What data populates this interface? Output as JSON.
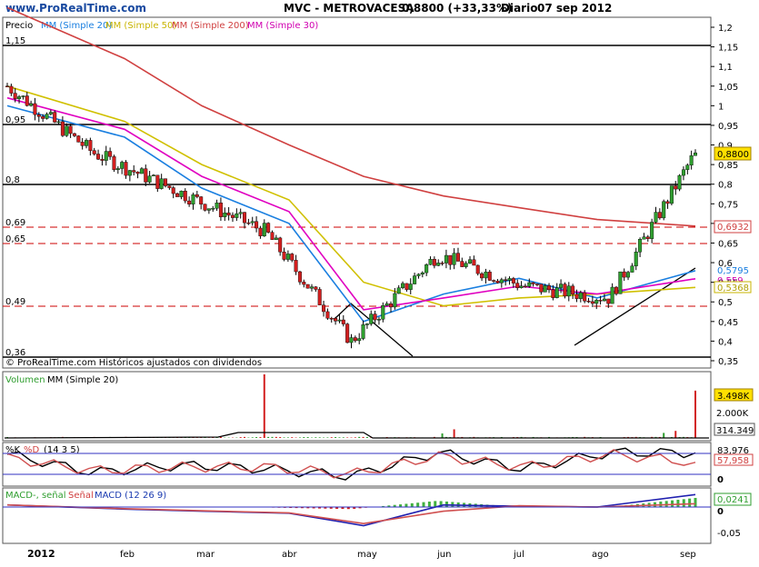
{
  "header": {
    "site": "www.ProRealTime.com",
    "ticker": "MVC - METROVACESA",
    "price": "0,8800 (+33,33%)",
    "period": "Diario",
    "date": "07 sep 2012"
  },
  "colors": {
    "up": "#2f9e2f",
    "down": "#d21f1f",
    "sma20": "#1a7fe0",
    "sma50": "#d0c000",
    "sma200": "#d04040",
    "sma30": "#e000c0",
    "macd": "#2020b0",
    "signal": "#d05050",
    "hist": "#40b040",
    "support": "#000000",
    "dashed": "#cc0000"
  },
  "price_panel": {
    "legend": {
      "precio": "Precio",
      "sma20": "MM (Simple 20)",
      "sma50": "MM (Simple 50)",
      "sma200": "MM (Simple 200)",
      "sma30": "MM (Simple 30)"
    },
    "footer": "© ProRealTime.com Históricos ajustados con dividendos",
    "left_levels": [
      "1,15",
      "0,95",
      "0,8",
      "0,69",
      "0,65",
      "0,49",
      "0,36"
    ],
    "right_ticks": [
      "1,2",
      "1,15",
      "1,1",
      "1,05",
      "1",
      "0,95",
      "0,9",
      "0,85",
      "0,8",
      "0,75",
      "0,7",
      "0,65",
      "0,6",
      "0,55",
      "0,5",
      "0,45",
      "0,4",
      "0,35"
    ],
    "value_labels": {
      "last": "0,8800",
      "sma200": "0,6932",
      "sma20": "0,5795",
      "sma30": "0,559",
      "sma50": "0,5368"
    }
  },
  "volume_panel": {
    "legend": {
      "volumen": "Volumen",
      "mm": "MM (Simple 20)"
    },
    "ticks": [
      "2.000K"
    ],
    "value_labels": {
      "last": "3.498K",
      "avg": "314.349"
    }
  },
  "stoch_panel": {
    "legend": {
      "k": "%K",
      "d": "%D",
      "params": "(14 3 5)"
    },
    "ticks": [
      "0"
    ],
    "value_labels": {
      "k": "83,976",
      "d": "57,958"
    }
  },
  "macd_panel": {
    "legend": {
      "macd": "MACD-, señal",
      "signal": "Señal",
      "params": "MACD (12 26 9)"
    },
    "ticks": [
      "0",
      "-0,05"
    ],
    "value_labels": {
      "hist": "0,0241"
    }
  },
  "x_axis": {
    "months": [
      "2012",
      "feb",
      "mar",
      "abr",
      "may",
      "jun",
      "jul",
      "ago",
      "sep"
    ]
  },
  "chart_data": [
    {
      "type": "line",
      "title": "MVC - METROVACESA",
      "x": [
        "2012-01",
        "2012-02",
        "2012-03",
        "2012-04",
        "2012-05",
        "2012-06",
        "2012-07",
        "2012-08",
        "2012-09"
      ],
      "ylim": [
        0.35,
        1.2
      ],
      "series": [
        {
          "name": "Precio",
          "values": [
            1.05,
            0.88,
            0.78,
            0.68,
            0.4,
            0.62,
            0.54,
            0.51,
            0.88
          ]
        },
        {
          "name": "MM (Simple 20)",
          "values": [
            1.0,
            0.92,
            0.79,
            0.7,
            0.45,
            0.52,
            0.56,
            0.51,
            0.5795
          ]
        },
        {
          "name": "MM (Simple 50)",
          "values": [
            1.05,
            0.96,
            0.85,
            0.76,
            0.55,
            0.49,
            0.51,
            0.52,
            0.5368
          ]
        },
        {
          "name": "MM (Simple 200)",
          "values": [
            1.25,
            1.12,
            1.0,
            0.9,
            0.82,
            0.77,
            0.74,
            0.71,
            0.6932
          ]
        },
        {
          "name": "MM (Simple 30)",
          "values": [
            1.02,
            0.94,
            0.82,
            0.73,
            0.48,
            0.51,
            0.54,
            0.52,
            0.559
          ]
        }
      ]
    },
    {
      "type": "bar",
      "title": "Volumen",
      "categories": [
        "2012",
        "feb",
        "mar",
        "abr",
        "may",
        "jun",
        "jul",
        "ago",
        "sep"
      ],
      "values": [
        180,
        160,
        150,
        4700,
        200,
        700,
        180,
        250,
        3498
      ]
    },
    {
      "type": "line",
      "title": "%K %D (14 3 5)",
      "x": [
        "2012",
        "feb",
        "mar",
        "abr",
        "may",
        "jun",
        "jul",
        "ago",
        "sep"
      ],
      "ylim": [
        0,
        100
      ],
      "series": [
        {
          "name": "%K",
          "values": [
            80,
            30,
            50,
            40,
            20,
            85,
            40,
            85,
            83.976
          ]
        },
        {
          "name": "%D",
          "values": [
            70,
            35,
            45,
            45,
            25,
            75,
            45,
            80,
            57.958
          ]
        }
      ]
    },
    {
      "type": "line",
      "title": "MACD (12 26 9)",
      "x": [
        "2012",
        "feb",
        "mar",
        "abr",
        "may",
        "jun",
        "jul",
        "ago",
        "sep"
      ],
      "ylim": [
        -0.07,
        0.04
      ],
      "series": [
        {
          "name": "MACD",
          "values": [
            0.005,
            -0.005,
            -0.01,
            -0.015,
            -0.045,
            0.005,
            0.002,
            0.0,
            0.03
          ]
        },
        {
          "name": "Señal",
          "values": [
            0.005,
            -0.004,
            -0.009,
            -0.014,
            -0.04,
            -0.01,
            0.003,
            0.0,
            0.008
          ]
        }
      ]
    }
  ]
}
